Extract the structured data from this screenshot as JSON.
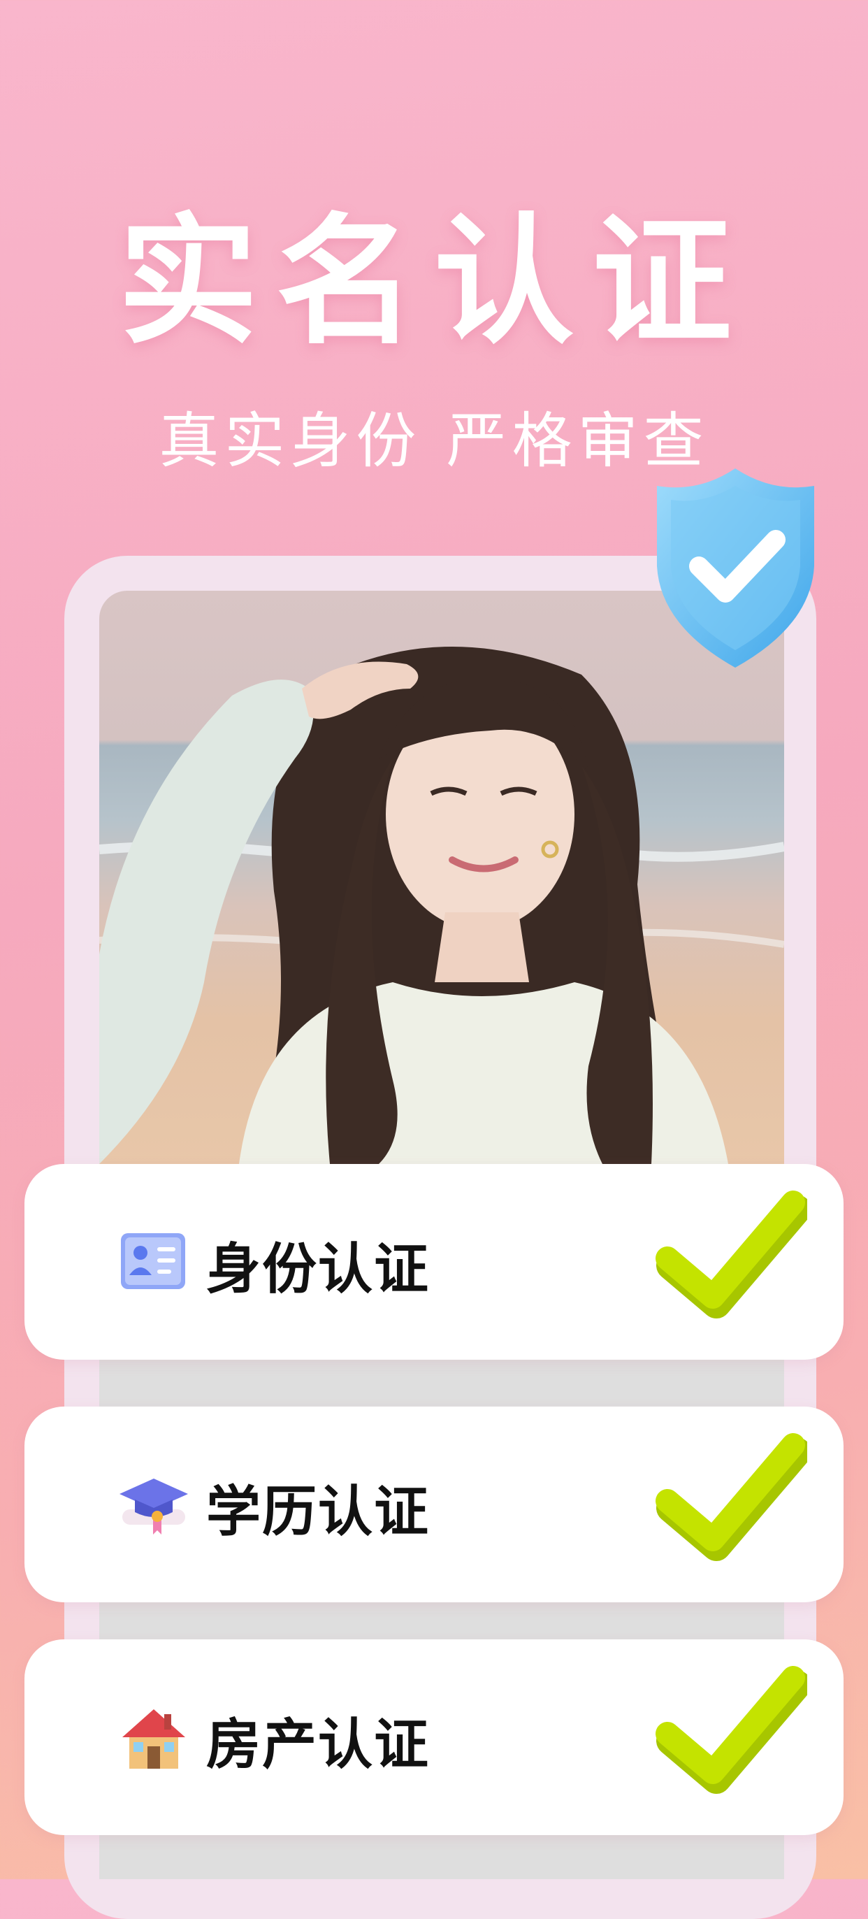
{
  "header": {
    "title": "实名认证",
    "subtitle": "真实身份 严格审查"
  },
  "verifications": [
    {
      "label": "身份认证",
      "icon": "id-card-icon",
      "checked": true
    },
    {
      "label": "学历认证",
      "icon": "graduation-cap-icon",
      "checked": true
    },
    {
      "label": "房产认证",
      "icon": "house-icon",
      "checked": true
    }
  ],
  "colors": {
    "background_top": "#f9b6cc",
    "background_bottom": "#f9c0a5",
    "check_green": "#b5d800",
    "shield_blue": "#62bff2"
  }
}
